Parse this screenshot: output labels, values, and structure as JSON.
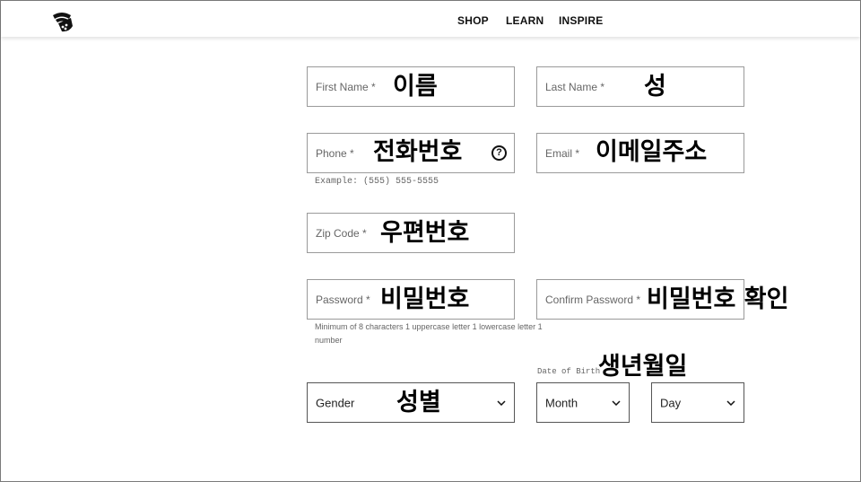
{
  "nav": {
    "shop": "SHOP",
    "learn": "LEARN",
    "inspire": "INSPIRE"
  },
  "form": {
    "first_name": {
      "label": "First Name *",
      "note": "이름"
    },
    "last_name": {
      "label": "Last Name *",
      "note": "성"
    },
    "phone": {
      "label": "Phone *",
      "note": "전화번호",
      "help": "?",
      "example": "Example: (555) 555-5555"
    },
    "email": {
      "label": "Email *",
      "note": "이메일주소"
    },
    "zip": {
      "label": "Zip Code *",
      "note": "우편번호"
    },
    "password": {
      "label": "Password *",
      "note": "비밀번호",
      "hint_line1": "Minimum of 8 characters 1 uppercase letter 1 lowercase letter 1",
      "hint_line2": "number"
    },
    "confirm_password": {
      "label": "Confirm Password *",
      "note": "비밀번호 확인"
    },
    "dob": {
      "label": "Date of Birth",
      "note": "생년월일"
    },
    "gender": {
      "label": "Gender",
      "note": "성별"
    },
    "month": {
      "label": "Month"
    },
    "day": {
      "label": "Day"
    }
  },
  "icons": {
    "logo": "brand-logo-icon",
    "help": "question-circle-icon",
    "chevron": "chevron-down-icon"
  }
}
